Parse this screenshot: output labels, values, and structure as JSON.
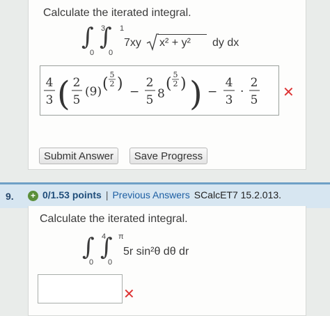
{
  "q8": {
    "prompt": "Calculate the iterated integral.",
    "outer_lower": "0",
    "outer_upper": "3",
    "inner_lower": "0",
    "inner_upper": "1",
    "integrand": "7xy",
    "radicand": "x² + y²",
    "differentials": "dy dx",
    "answer": {
      "c1_num": "4",
      "c1_den": "3",
      "f1_num": "2",
      "f1_den": "5",
      "base1": "(9)",
      "exp_num": "5",
      "exp_den": "2",
      "minus": "−",
      "f2_num": "2",
      "f2_den": "5",
      "base2": "8",
      "c2_num": "4",
      "c2_den": "3",
      "c3_num": "2",
      "c3_den": "5",
      "dot": "·"
    },
    "status": "incorrect",
    "submit_label": "Submit Answer",
    "save_label": "Save Progress"
  },
  "q9": {
    "number": "9.",
    "points": "0/1.53 points",
    "separator": "|",
    "previous_answers": "Previous Answers",
    "source": "SCalcET7 15.2.013.",
    "prompt": "Calculate the iterated integral.",
    "outer_lower": "0",
    "outer_upper": "4",
    "inner_lower": "0",
    "inner_upper": "π",
    "integrand": "5r sin²θ dθ dr",
    "answer_value": "",
    "status": "incorrect"
  },
  "colors": {
    "incorrect": "#dd3333",
    "link": "#1d5fa3",
    "question_bar": "#d7e6f1",
    "plus_badge": "#5b8f3a"
  },
  "icons": [
    "incorrect-x-icon",
    "plus-circle-icon"
  ]
}
